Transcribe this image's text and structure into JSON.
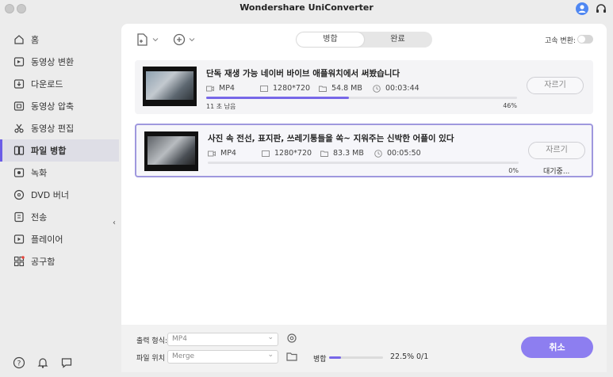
{
  "window": {
    "title": "Wondershare UniConverter"
  },
  "sidebar": {
    "items": [
      {
        "label": "홈",
        "icon": "home-icon"
      },
      {
        "label": "동영상 변환",
        "icon": "convert-icon"
      },
      {
        "label": "다운로드",
        "icon": "download-icon"
      },
      {
        "label": "동영상 압축",
        "icon": "compress-icon"
      },
      {
        "label": "동영상 편집",
        "icon": "scissors-icon"
      },
      {
        "label": "파일 병합",
        "icon": "merge-icon",
        "active": true
      },
      {
        "label": "녹화",
        "icon": "record-icon"
      },
      {
        "label": "DVD 버너",
        "icon": "dvd-icon"
      },
      {
        "label": "전송",
        "icon": "transfer-icon"
      },
      {
        "label": "플레이어",
        "icon": "player-icon"
      },
      {
        "label": "공구함",
        "icon": "toolbox-icon"
      }
    ]
  },
  "toolbar": {
    "tabs": [
      {
        "label": "병합",
        "active": true
      },
      {
        "label": "완료",
        "active": false
      }
    ],
    "speed_label": "고속 변환:"
  },
  "files": [
    {
      "title": "단독 재생 가능 네이버 바이브 애플워치에서 써봤습니다",
      "format": "MP4",
      "resolution": "1280*720",
      "size": "54.8 MB",
      "duration": "00:03:44",
      "progress": 46,
      "remaining": "11 초 남음",
      "percent_text": "46%",
      "cut_label": "자르기",
      "status": ""
    },
    {
      "title": "사진 속 전선, 표지판, 쓰레기통들을 쏙~ 지워주는 신박한 어플이 있다",
      "format": "MP4",
      "resolution": "1280*720",
      "size": "83.3 MB",
      "duration": "00:05:50",
      "progress": 0,
      "remaining": "",
      "percent_text": "0%",
      "cut_label": "자르기",
      "status": "대기중..."
    }
  ],
  "footer": {
    "output_format_label": "출력 형식:",
    "output_format_value": "MP4",
    "file_location_label": "파일 위치 :",
    "file_location_value": "Merge",
    "merge_label": "병합",
    "merge_progress": 22.5,
    "merge_percent_text": "22.5%",
    "merge_count": "0/1",
    "cancel_label": "취소"
  },
  "colors": {
    "accent": "#7767e8",
    "button": "#8d7ef0",
    "selected_border": "#9f98de"
  }
}
